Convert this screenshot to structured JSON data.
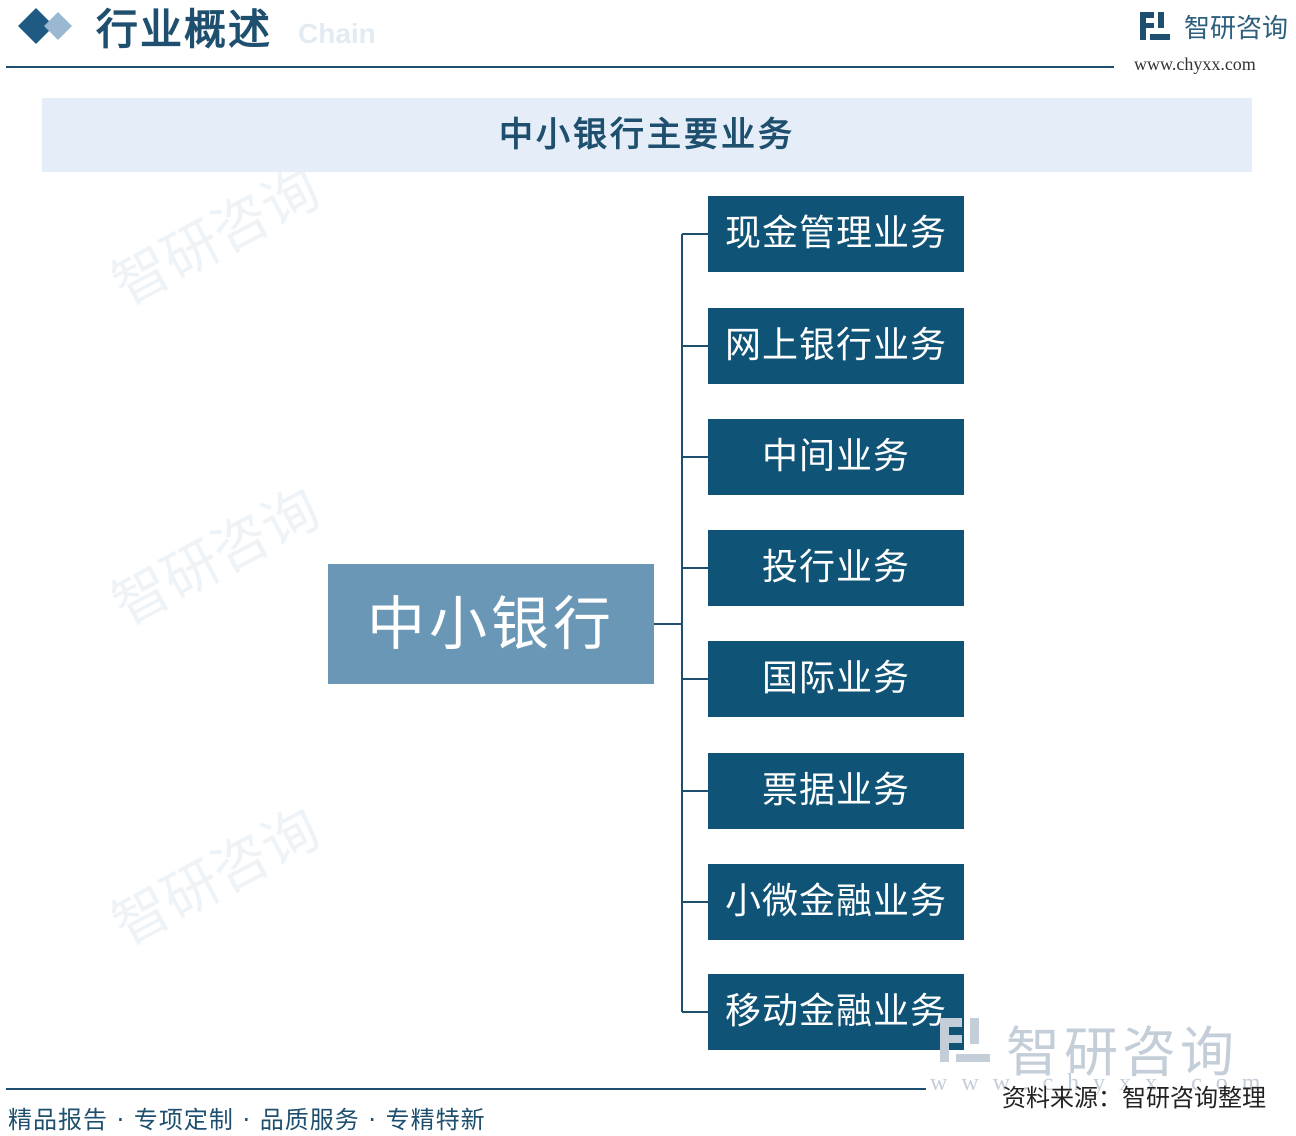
{
  "header": {
    "section_title": "行业概述",
    "faint_subtitle": "Chain",
    "logo_name": "智研咨询",
    "logo_url": "www.chyxx.com"
  },
  "banner": {
    "title": "中小银行主要业务"
  },
  "diagram": {
    "root": "中小银行",
    "branches": [
      "现金管理业务",
      "网上银行业务",
      "中间业务",
      "投行业务",
      "国际业务",
      "票据业务",
      "小微金融业务",
      "移动金融业务"
    ]
  },
  "watermark": {
    "text": "智研咨询"
  },
  "footer": {
    "slogan": "精品报告 · 专项定制 · 品质服务 · 专精特新",
    "source": "资料来源：智研咨询整理",
    "big_logo_name": "智研咨询",
    "big_logo_url": "www.chyxx.com"
  },
  "colors": {
    "primary": "#1e4f6e",
    "branch_box": "#0f5376",
    "root_box": "#6a97b5",
    "banner_bg": "#e5eef8"
  }
}
